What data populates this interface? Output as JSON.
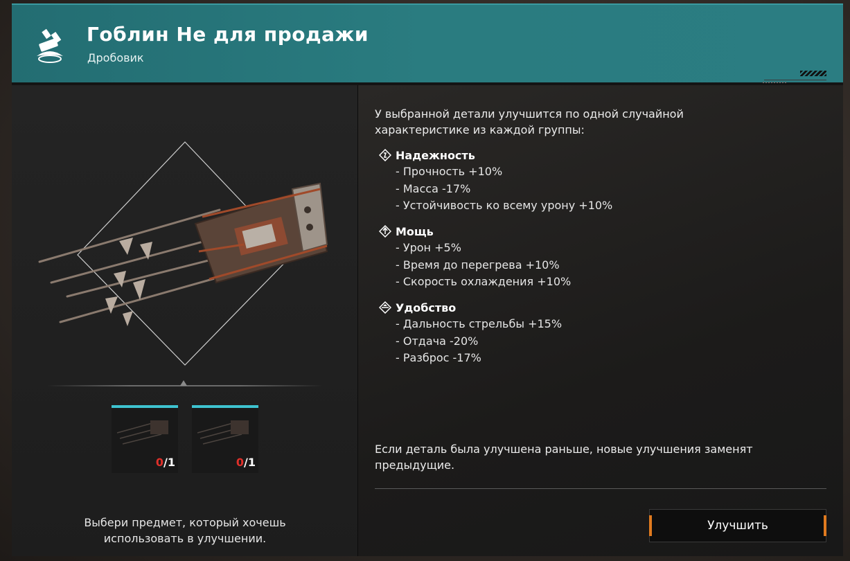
{
  "header": {
    "title": "Гоблин Не для продажи",
    "subtitle": "Дробовик",
    "accent_color": "#2a7c80",
    "icon": "shotgun-weapon-icon"
  },
  "slots": [
    {
      "current": "0",
      "total": "/1"
    },
    {
      "current": "0",
      "total": "/1"
    }
  ],
  "left_hint": "Выбери предмет, который хочешь использовать в улучшении.",
  "intro": "У выбранной детали улучшится по одной случайной характеристике из каждой группы:",
  "groups": [
    {
      "title": "Надежность",
      "icon": "reliability-icon",
      "items": [
        "- Прочность +10%",
        "- Масса -17%",
        "- Устойчивость ко всему урону +10%"
      ]
    },
    {
      "title": "Мощь",
      "icon": "power-icon",
      "items": [
        "- Урон +5%",
        "- Время до перегрева +10%",
        "- Скорость охлаждения +10%"
      ]
    },
    {
      "title": "Удобство",
      "icon": "handling-icon",
      "items": [
        "- Дальность стрельбы +15%",
        "- Отдача -20%",
        "- Разброс -17%"
      ]
    }
  ],
  "note": "Если деталь была улучшена раньше, новые улучшения заменят предыдущие.",
  "button": {
    "label": "Улучшить",
    "accent_color": "#e07a1f"
  },
  "slot_accent_color": "#3ec3d0",
  "count_warning_color": "#e0302a"
}
